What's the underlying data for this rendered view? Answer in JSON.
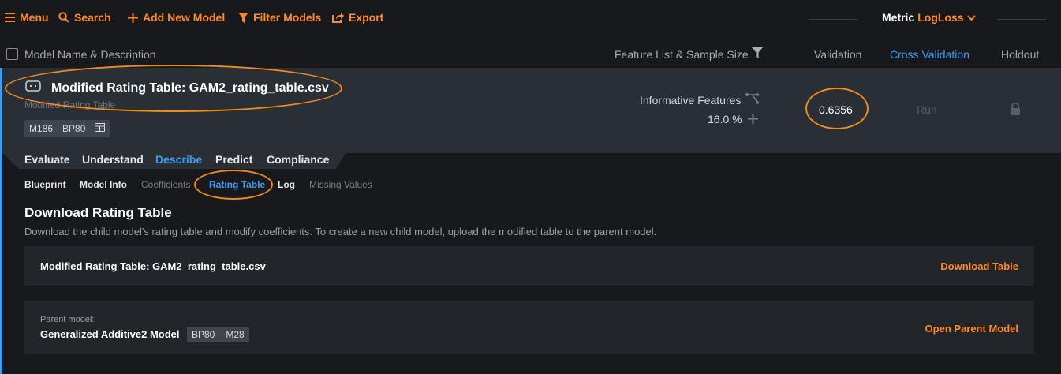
{
  "toolbar": {
    "menu": "Menu",
    "search": "Search",
    "add": "Add New Model",
    "filter": "Filter Models",
    "export": "Export",
    "metric_label": "Metric",
    "metric_value": "LogLoss"
  },
  "header": {
    "model_name": "Model Name & Description",
    "feature_list": "Feature List & Sample Size",
    "validation": "Validation",
    "cross_validation": "Cross Validation",
    "holdout": "Holdout"
  },
  "model": {
    "title": "Modified Rating Table: GAM2_rating_table.csv",
    "subtitle": "Modified Rating Table",
    "badge_m": "M186",
    "badge_bp": "BP80",
    "features": "Informative Features",
    "sample_pct": "16.0 %",
    "validation_score": "0.6356",
    "cv_action": "Run"
  },
  "tabs": [
    "Evaluate",
    "Understand",
    "Describe",
    "Predict",
    "Compliance"
  ],
  "subtabs": [
    "Blueprint",
    "Model Info",
    "Coefficients",
    "Rating Table",
    "Log",
    "Missing Values"
  ],
  "content": {
    "title": "Download Rating Table",
    "description": "Download the child model's rating table and modify coefficients. To create a new child model, upload the modified table to the parent model.",
    "card1_text": "Modified Rating Table: GAM2_rating_table.csv",
    "card1_action": "Download Table",
    "parent_label": "Parent model:",
    "parent_name": "Generalized Additive2 Model",
    "parent_bp": "BP80",
    "parent_m": "M28",
    "card2_action": "Open Parent Model"
  },
  "colors": {
    "accent": "#ff8a1f",
    "active": "#3d9df0",
    "background": "#17191d",
    "row": "#2a2e35",
    "annotation": "#f08a1c"
  }
}
